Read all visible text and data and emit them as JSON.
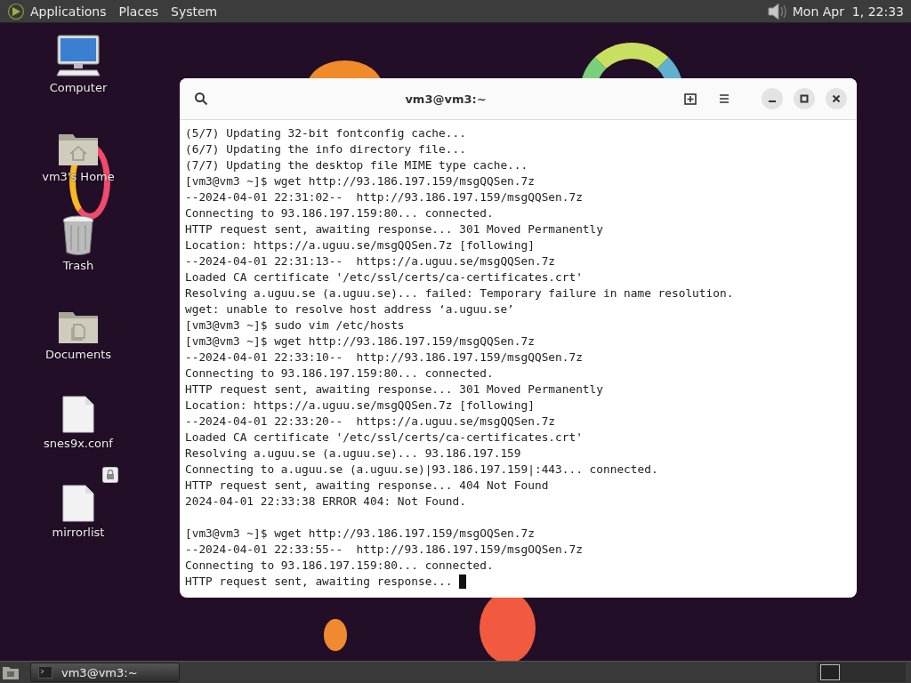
{
  "top_panel": {
    "menus": [
      "Applications",
      "Places",
      "System"
    ],
    "clock": "Mon Apr  1, 22:33"
  },
  "desktop_icons": [
    {
      "label": "Computer",
      "kind": "computer"
    },
    {
      "label": "vm3's Home",
      "kind": "home"
    },
    {
      "label": "Trash",
      "kind": "trash"
    },
    {
      "label": "Documents",
      "kind": "folder"
    },
    {
      "label": "snes9x.conf",
      "kind": "file"
    },
    {
      "label": "mirrorlist",
      "kind": "locked-file"
    }
  ],
  "terminal": {
    "title": "vm3@vm3:~",
    "blocks": [
      [
        "(5/7) Updating 32-bit fontconfig cache...",
        "(6/7) Updating the info directory file...",
        "(7/7) Updating the desktop file MIME type cache...",
        "[vm3@vm3 ~]$ wget http://93.186.197.159/msgQQSen.7z",
        "--2024-04-01 22:31:02--  http://93.186.197.159/msgQQSen.7z",
        "Connecting to 93.186.197.159:80... connected.",
        "HTTP request sent, awaiting response... 301 Moved Permanently",
        "Location: https://a.uguu.se/msgQQSen.7z [following]",
        "--2024-04-01 22:31:13--  https://a.uguu.se/msgQQSen.7z",
        "Loaded CA certificate '/etc/ssl/certs/ca-certificates.crt'",
        "Resolving a.uguu.se (a.uguu.se)... failed: Temporary failure in name resolution.",
        "wget: unable to resolve host address ‘a.uguu.se’",
        "[vm3@vm3 ~]$ sudo vim /etc/hosts",
        "[vm3@vm3 ~]$ wget http://93.186.197.159/msgQQSen.7z",
        "--2024-04-01 22:33:10--  http://93.186.197.159/msgQQSen.7z",
        "Connecting to 93.186.197.159:80... connected.",
        "HTTP request sent, awaiting response... 301 Moved Permanently",
        "Location: https://a.uguu.se/msgQQSen.7z [following]",
        "--2024-04-01 22:33:20--  https://a.uguu.se/msgQQSen.7z",
        "Loaded CA certificate '/etc/ssl/certs/ca-certificates.crt'",
        "Resolving a.uguu.se (a.uguu.se)... 93.186.197.159",
        "Connecting to a.uguu.se (a.uguu.se)|93.186.197.159|:443... connected.",
        "HTTP request sent, awaiting response... 404 Not Found",
        "2024-04-01 22:33:38 ERROR 404: Not Found."
      ],
      [
        "[vm3@vm3 ~]$ wget http://93.186.197.159/msgOQSen.7z",
        "--2024-04-01 22:33:55--  http://93.186.197.159/msgOQSen.7z",
        "Connecting to 93.186.197.159:80... connected.",
        "HTTP request sent, awaiting response... "
      ]
    ]
  },
  "taskbar": {
    "windows": [
      "vm3@vm3:~"
    ]
  }
}
